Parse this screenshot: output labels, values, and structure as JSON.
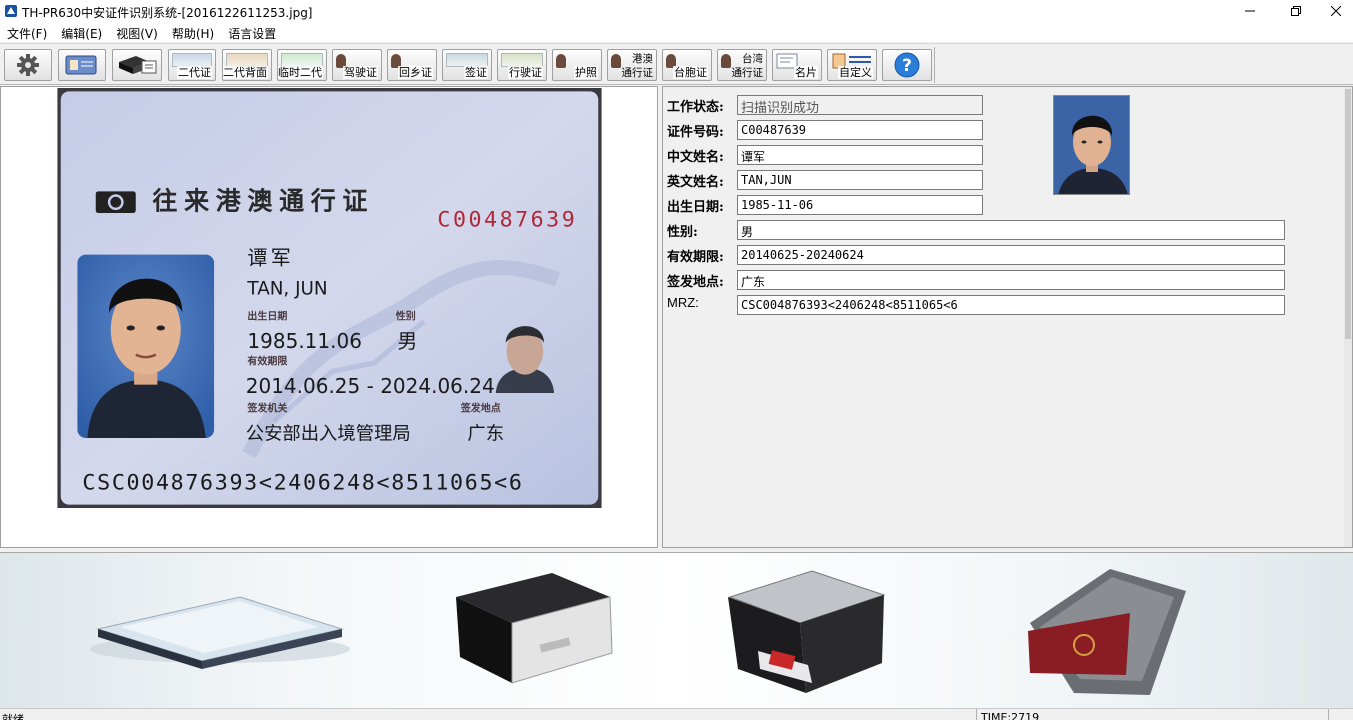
{
  "window": {
    "title": "TH-PR630中安证件识别系统-[2016122611253.jpg]"
  },
  "menu": [
    "文件(F)",
    "编辑(E)",
    "视图(V)",
    "帮助(H)",
    "语言设置"
  ],
  "toolbar": {
    "buttons": [
      {
        "label": "",
        "icon": "gear-icon"
      },
      {
        "label": "",
        "icon": "card-scan-icon"
      },
      {
        "label": "",
        "icon": "scanner-icon"
      },
      {
        "label": "二代证",
        "icon": "id-card-icon"
      },
      {
        "label": "二代背面",
        "icon": "id-card-back-icon"
      },
      {
        "label": "临时二代",
        "icon": "temp-id-icon"
      },
      {
        "label": "驾驶证",
        "icon": "driver-license-icon"
      },
      {
        "label": "回乡证",
        "icon": "home-return-permit-icon"
      },
      {
        "label": "签证",
        "icon": "visa-icon"
      },
      {
        "label": "行驶证",
        "icon": "vehicle-license-icon"
      },
      {
        "label": "护照",
        "icon": "passport-icon"
      },
      {
        "label": "港澳",
        "label2": "通行证",
        "icon": "hk-macau-permit-icon"
      },
      {
        "label": "台胞证",
        "icon": "taiwan-compatriot-icon"
      },
      {
        "label": "台湾",
        "label2": "通行证",
        "icon": "taiwan-permit-icon"
      },
      {
        "label": "名片",
        "icon": "business-card-icon"
      },
      {
        "label": "自定义",
        "icon": "custom-icon"
      },
      {
        "label": "",
        "icon": "help-icon"
      }
    ]
  },
  "card": {
    "title": "往来港澳通行证",
    "number": "C00487639",
    "name_cn": "谭军",
    "name_en": "TAN, JUN",
    "dob_label": "出生日期",
    "sex_label": "性别",
    "dob": "1985.11.06",
    "sex": "男",
    "validity_label": "有效期限",
    "validity": "2014.06.25 - 2024.06.24",
    "authority_label": "签发机关",
    "place_label": "签发地点",
    "authority": "公安部出入境管理局",
    "place": "广东",
    "mrz": "CSC004876393<2406248<8511065<6"
  },
  "fields": [
    {
      "label": "工作状态:",
      "value": "扫描识别成功",
      "readonly": true
    },
    {
      "label": "证件号码:",
      "value": "C00487639"
    },
    {
      "label": "中文姓名:",
      "value": "谭军"
    },
    {
      "label": "英文姓名:",
      "value": "TAN,JUN"
    },
    {
      "label": "出生日期:",
      "value": "1985-11-06"
    },
    {
      "label": "性别:",
      "value": "男"
    },
    {
      "label": "有效期限:",
      "value": "20140625-20240624"
    },
    {
      "label": "签发地点:",
      "value": "广东"
    },
    {
      "label": "MRZ:",
      "value": "CSC004876393<2406248<8511065<6"
    }
  ],
  "status": {
    "text": "就绪",
    "time": "TIME:2719"
  }
}
